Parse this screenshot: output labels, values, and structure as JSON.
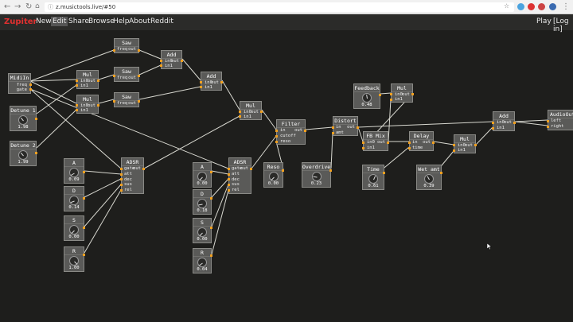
{
  "browser": {
    "url": "z.musictools.live/#50"
  },
  "app": {
    "logo": "Zupiter",
    "menu": [
      {
        "key": "new",
        "label": "New"
      },
      {
        "key": "edit",
        "label": "Edit"
      },
      {
        "key": "share",
        "label": "Share"
      },
      {
        "key": "browse",
        "label": "Browse"
      },
      {
        "key": "help",
        "label": "Help"
      },
      {
        "key": "about",
        "label": "About"
      },
      {
        "key": "reddit",
        "label": "Reddit"
      }
    ],
    "play_label": "Play",
    "login_label": "[Log in]"
  },
  "nodes": {
    "midiin": {
      "title": "MidiIn",
      "ports": [
        "freq",
        "gate"
      ]
    },
    "detune1": {
      "title": "Detune 1",
      "value": "1.98"
    },
    "detune2": {
      "title": "Detune 2",
      "value": "1.99"
    },
    "saw1": {
      "title": "Saw",
      "ports": [
        "freq",
        "out"
      ]
    },
    "saw2": {
      "title": "Saw",
      "ports": [
        "freq",
        "out"
      ]
    },
    "saw3": {
      "title": "Saw",
      "ports": [
        "freq",
        "out"
      ]
    },
    "mul1": {
      "title": "Mul",
      "ports": [
        "in0",
        "out",
        "in1"
      ]
    },
    "mul2": {
      "title": "Mul",
      "ports": [
        "in0",
        "out",
        "in1"
      ]
    },
    "add1": {
      "title": "Add",
      "ports": [
        "in0",
        "out",
        "in1"
      ]
    },
    "add2": {
      "title": "Add",
      "ports": [
        "in0",
        "out",
        "in1"
      ]
    },
    "mul3": {
      "title": "Mul",
      "ports": [
        "in0",
        "out",
        "in1"
      ]
    },
    "adsr1": {
      "title": "ADSR",
      "ports": [
        "gate",
        "out",
        "att",
        "dec",
        "sus",
        "rel"
      ]
    },
    "a1": {
      "title": "A",
      "value": "0.09"
    },
    "d1": {
      "title": "D",
      "value": "0.14"
    },
    "s1": {
      "title": "S",
      "value": "0.00"
    },
    "r1": {
      "title": "R",
      "value": "1.00"
    },
    "adsr2": {
      "title": "ADSR",
      "ports": [
        "gate",
        "out",
        "att",
        "dec",
        "sus",
        "rel"
      ]
    },
    "a2": {
      "title": "A",
      "value": "0.00"
    },
    "d2": {
      "title": "D",
      "value": "0.18"
    },
    "s2": {
      "title": "S",
      "value": "0.00"
    },
    "r2": {
      "title": "R",
      "value": "0.04"
    },
    "filter": {
      "title": "Filter",
      "ports": [
        "in",
        "out",
        "cutoff",
        "reso"
      ]
    },
    "reso": {
      "title": "Reso",
      "value": "0.00"
    },
    "distort": {
      "title": "Distort",
      "ports": [
        "in",
        "out",
        "amt"
      ]
    },
    "overdrive": {
      "title": "Overdrive",
      "value": "0.23"
    },
    "feedback": {
      "title": "Feedback",
      "value": "0.48"
    },
    "mul4": {
      "title": "Mul",
      "ports": [
        "in0",
        "out",
        "in1"
      ]
    },
    "fbmix": {
      "title": "FB Mix",
      "ports": [
        "in0",
        "out",
        "in1"
      ]
    },
    "delay": {
      "title": "Delay",
      "ports": [
        "in",
        "out",
        "time"
      ]
    },
    "time": {
      "title": "Time",
      "value": "0.61"
    },
    "mul5": {
      "title": "Mul",
      "ports": [
        "in0",
        "out",
        "in1"
      ]
    },
    "wetamt": {
      "title": "Wet amt",
      "value": "0.39"
    },
    "add3": {
      "title": "Add",
      "ports": [
        "in0",
        "out",
        "in1"
      ]
    },
    "audioout": {
      "title": "AudioOut",
      "ports": [
        "left",
        "right"
      ]
    }
  }
}
